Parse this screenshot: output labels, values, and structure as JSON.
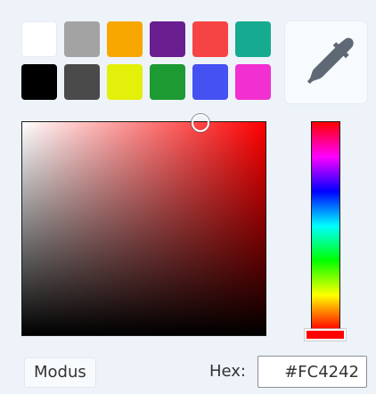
{
  "swatches": [
    {
      "name": "white",
      "color": "#ffffff"
    },
    {
      "name": "gray",
      "color": "#a3a3a3"
    },
    {
      "name": "orange",
      "color": "#f7a700"
    },
    {
      "name": "purple",
      "color": "#6a1e8f"
    },
    {
      "name": "red",
      "color": "#f64444"
    },
    {
      "name": "teal",
      "color": "#16ab90"
    },
    {
      "name": "black",
      "color": "#000000"
    },
    {
      "name": "dark-gray",
      "color": "#4a4a4a"
    },
    {
      "name": "yellow",
      "color": "#e3f00a"
    },
    {
      "name": "green",
      "color": "#1d9a31"
    },
    {
      "name": "blue",
      "color": "#4651f2"
    },
    {
      "name": "magenta",
      "color": "#f22fd0"
    }
  ],
  "eyedropper": {
    "icon": "eyedropper-icon",
    "color": "#5f6976"
  },
  "picker": {
    "hue_color": "#ff0000",
    "saturation": 0.73,
    "brightness": 0.99,
    "hue_level": 0.0
  },
  "footer": {
    "mode_label": "Modus",
    "hex_label": "Hex:",
    "hex_value": "#FC4242"
  }
}
